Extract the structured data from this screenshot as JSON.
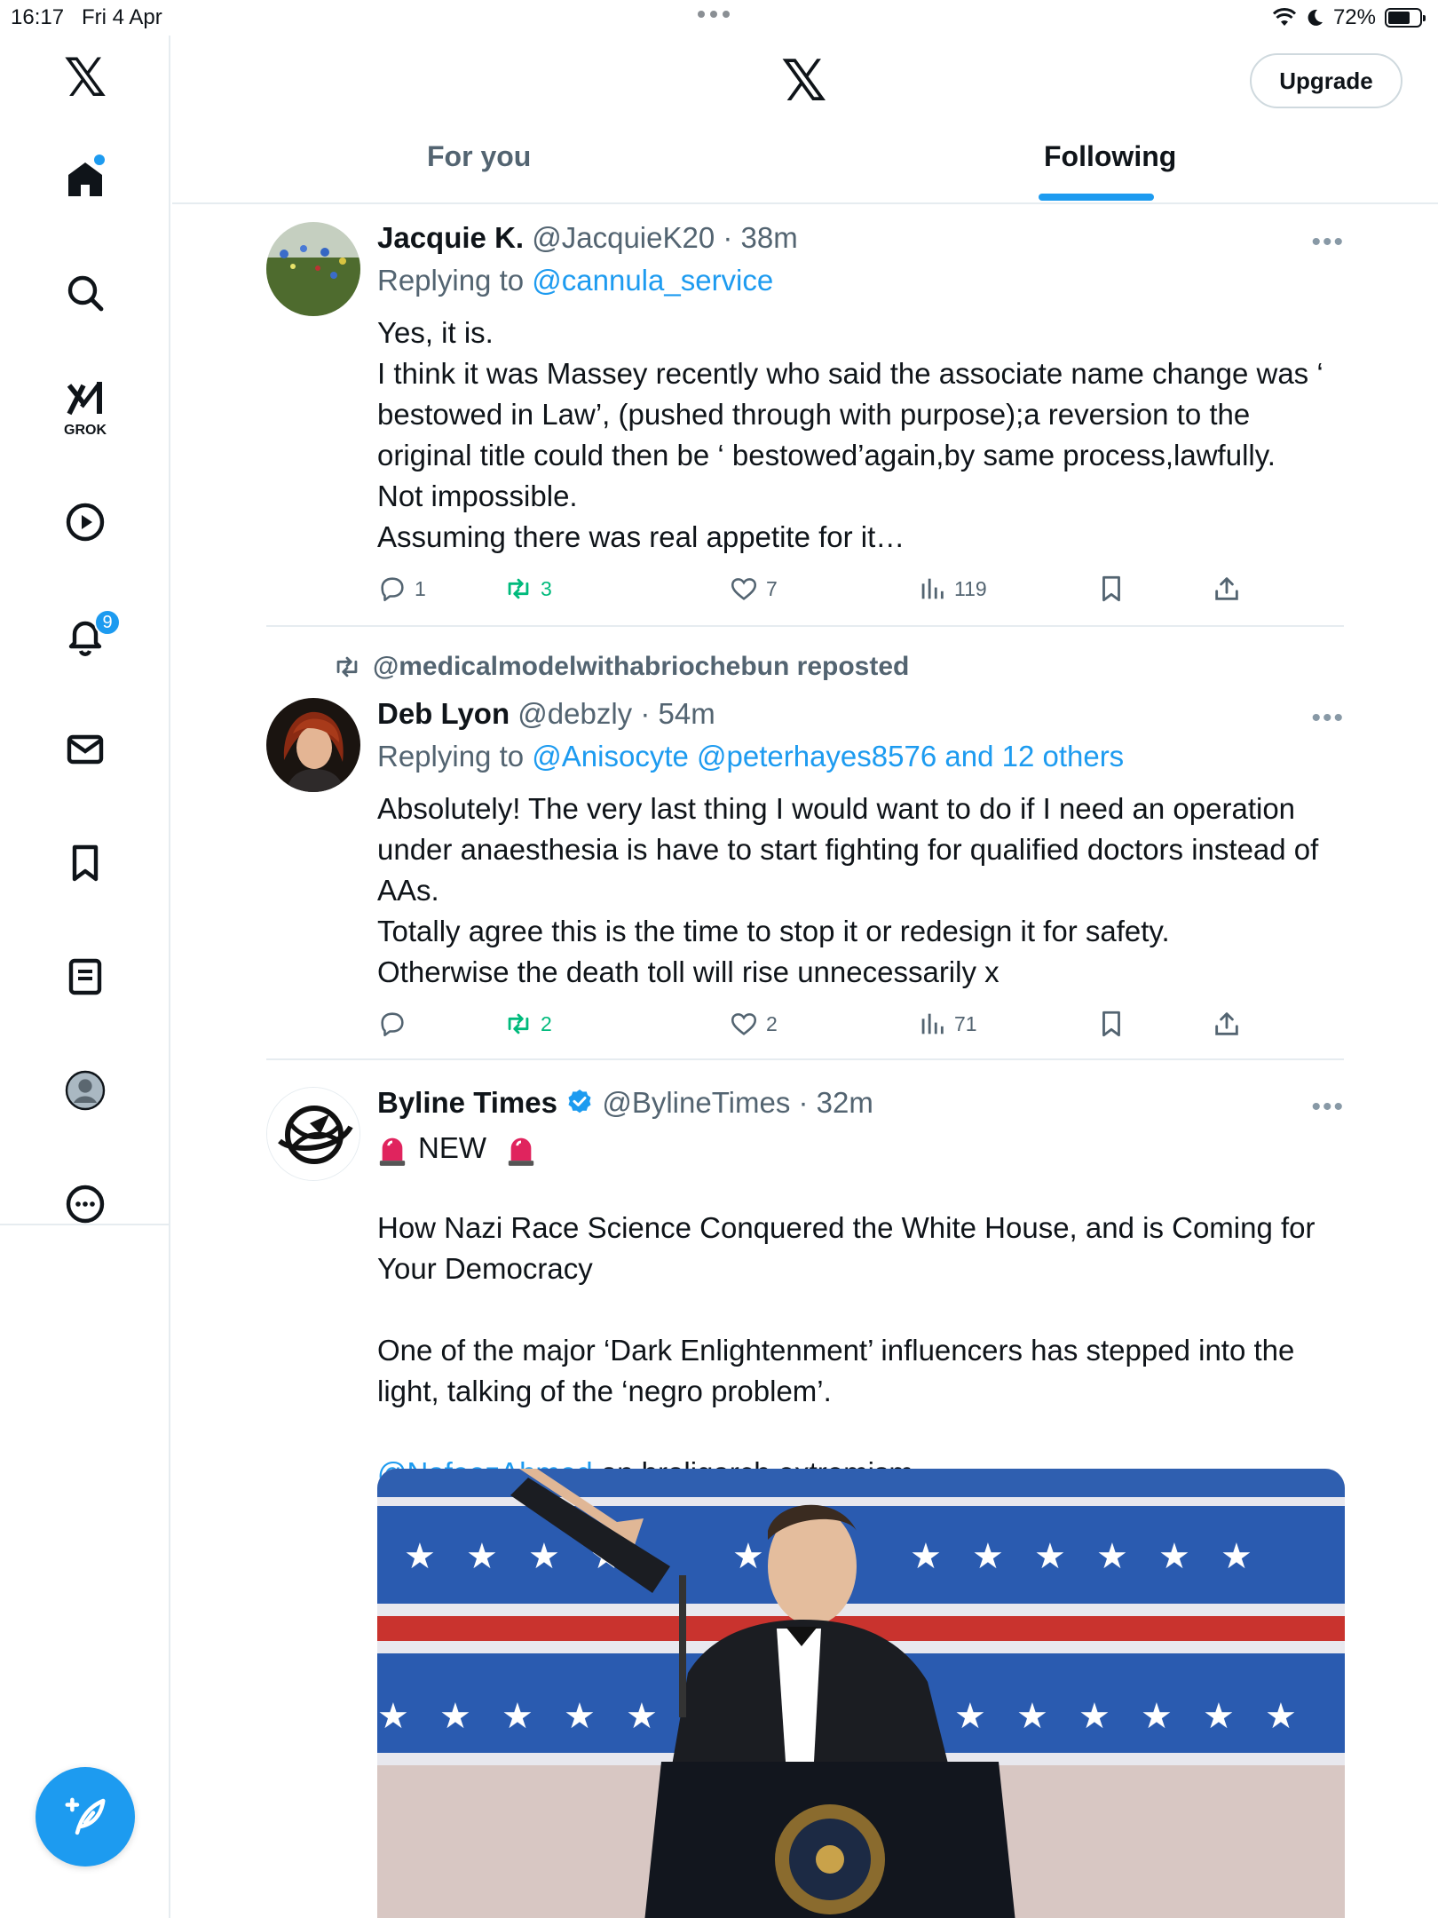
{
  "status_bar": {
    "time": "16:17",
    "date": "Fri 4 Apr",
    "battery": "72%",
    "battery_level": 0.72
  },
  "sidebar": {
    "items": [
      {
        "name": "home",
        "icon": "home-icon"
      },
      {
        "name": "search",
        "icon": "search-icon"
      },
      {
        "name": "grok",
        "icon": "grok-icon",
        "label": "GROK"
      },
      {
        "name": "video",
        "icon": "play-icon"
      },
      {
        "name": "notifications",
        "icon": "bell-icon",
        "badge": "9"
      },
      {
        "name": "messages",
        "icon": "mail-icon"
      },
      {
        "name": "bookmarks",
        "icon": "bookmark-icon"
      },
      {
        "name": "lists",
        "icon": "list-icon"
      },
      {
        "name": "profile",
        "icon": "profile-icon"
      },
      {
        "name": "more",
        "icon": "more-circle-icon"
      }
    ]
  },
  "header": {
    "logo": "𝕏",
    "upgrade_label": "Upgrade",
    "tabs": [
      {
        "label": "For you",
        "active": false
      },
      {
        "label": "Following",
        "active": true
      }
    ]
  },
  "tweets": [
    {
      "name": "Jacquie K.",
      "handle": "@JacquieK20",
      "time": "38m",
      "replying_prefix": "Replying to ",
      "replying_to": "@cannula_service",
      "text": "Yes, it is.\nI think it was Massey recently who said the associate name change was ‘ bestowed in Law’, (pushed through with purpose);a reversion to the original title could then be ‘ bestowed’again,by same process,lawfully.\nNot impossible.\nAssuming there was real appetite for it…",
      "replies": "1",
      "reposts": "3",
      "likes": "7",
      "views": "119"
    },
    {
      "reposted_by": "@medicalmodelwithabriochebun reposted",
      "name": "Deb Lyon",
      "handle": "@debzly",
      "time": "54m",
      "replying_prefix": "Replying to ",
      "replying_to": "@Anisocyte @peterhayes8576 and 12 others",
      "text": "Absolutely! The very last thing I would want to do if I need an operation under anaesthesia is have to start fighting for qualified doctors instead of AAs.\nTotally agree this is the time to stop it or redesign it for safety.\nOtherwise the death toll will rise unnecessarily x",
      "replies": "",
      "reposts": "2",
      "likes": "2",
      "views": "71"
    },
    {
      "name": "Byline Times",
      "handle": "@BylineTimes",
      "time": "32m",
      "verified": true,
      "siren_text": "NEW",
      "headline": "How Nazi Race Science Conquered the White House, and is Coming for Your Democracy",
      "text": "One of the major ‘Dark Enlightenment’ influencers has stepped into the light, talking of the ‘negro problem’.",
      "mention": "@NafeezAhmed",
      "mention_suffix": " on broligarch extremism"
    }
  ],
  "separator": " · ",
  "more_dots": "•••",
  "colors": {
    "accent": "#1d9bf0",
    "repost_green": "#00ba7c",
    "secondary_text": "#536471"
  }
}
